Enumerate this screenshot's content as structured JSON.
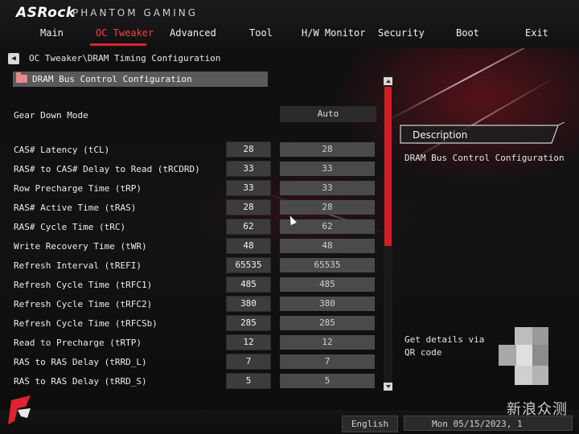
{
  "brand": {
    "logo": "ASRock",
    "sub": "PHANTOM GAMING"
  },
  "nav": [
    "Main",
    "OC Tweaker",
    "Advanced",
    "Tool",
    "H/W Monitor",
    "Security",
    "Boot",
    "Exit"
  ],
  "nav_active": "OC Tweaker",
  "breadcrumb": "OC Tweaker\\DRAM Timing Configuration",
  "section": "DRAM Bus Control Configuration",
  "gear": {
    "label": "Gear Down Mode",
    "value": "Auto"
  },
  "rows": [
    {
      "label": "CAS# Latency (tCL)",
      "value": "28",
      "current": "28"
    },
    {
      "label": "RAS# to CAS# Delay to Read  (tRCDRD)",
      "value": "33",
      "current": "33"
    },
    {
      "label": "Row Precharge Time (tRP)",
      "value": "33",
      "current": "33"
    },
    {
      "label": "RAS# Active Time (tRAS)",
      "value": "28",
      "current": "28"
    },
    {
      "label": "RAS# Cycle Time (tRC)",
      "value": "62",
      "current": "62"
    },
    {
      "label": "Write Recovery Time (tWR)",
      "value": "48",
      "current": "48"
    },
    {
      "label": "Refresh Interval (tREFI)",
      "value": "65535",
      "current": "65535"
    },
    {
      "label": "Refresh Cycle Time (tRFC1)",
      "value": "485",
      "current": "485"
    },
    {
      "label": "Refresh Cycle Time (tRFC2)",
      "value": "380",
      "current": "380"
    },
    {
      "label": "Refresh Cycle Time (tRFCSb)",
      "value": "285",
      "current": "285"
    },
    {
      "label": "Read to Precharge (tRTP)",
      "value": "12",
      "current": "12"
    },
    {
      "label": "RAS to RAS Delay (tRRD_L)",
      "value": "7",
      "current": "7"
    },
    {
      "label": "RAS to RAS Delay (tRRD_S)",
      "value": "5",
      "current": "5"
    }
  ],
  "description": {
    "title": "Description",
    "text": "DRAM Bus Control Configuration"
  },
  "qr_text": "Get details via QR code",
  "footer": {
    "language": "English",
    "datetime": "Mon 05/15/2023, 1"
  },
  "watermark": "新浪众测",
  "icons": {
    "back": "back-arrow-icon",
    "section": "folder-icon",
    "logo": "phantom-gaming-logo-icon",
    "scroll_up": "scroll-up-icon",
    "scroll_down": "scroll-down-icon"
  },
  "colors": {
    "accent": "#e0232e",
    "active_tab": "#ff3b3b",
    "scroll_thumb": "#d21d25"
  }
}
